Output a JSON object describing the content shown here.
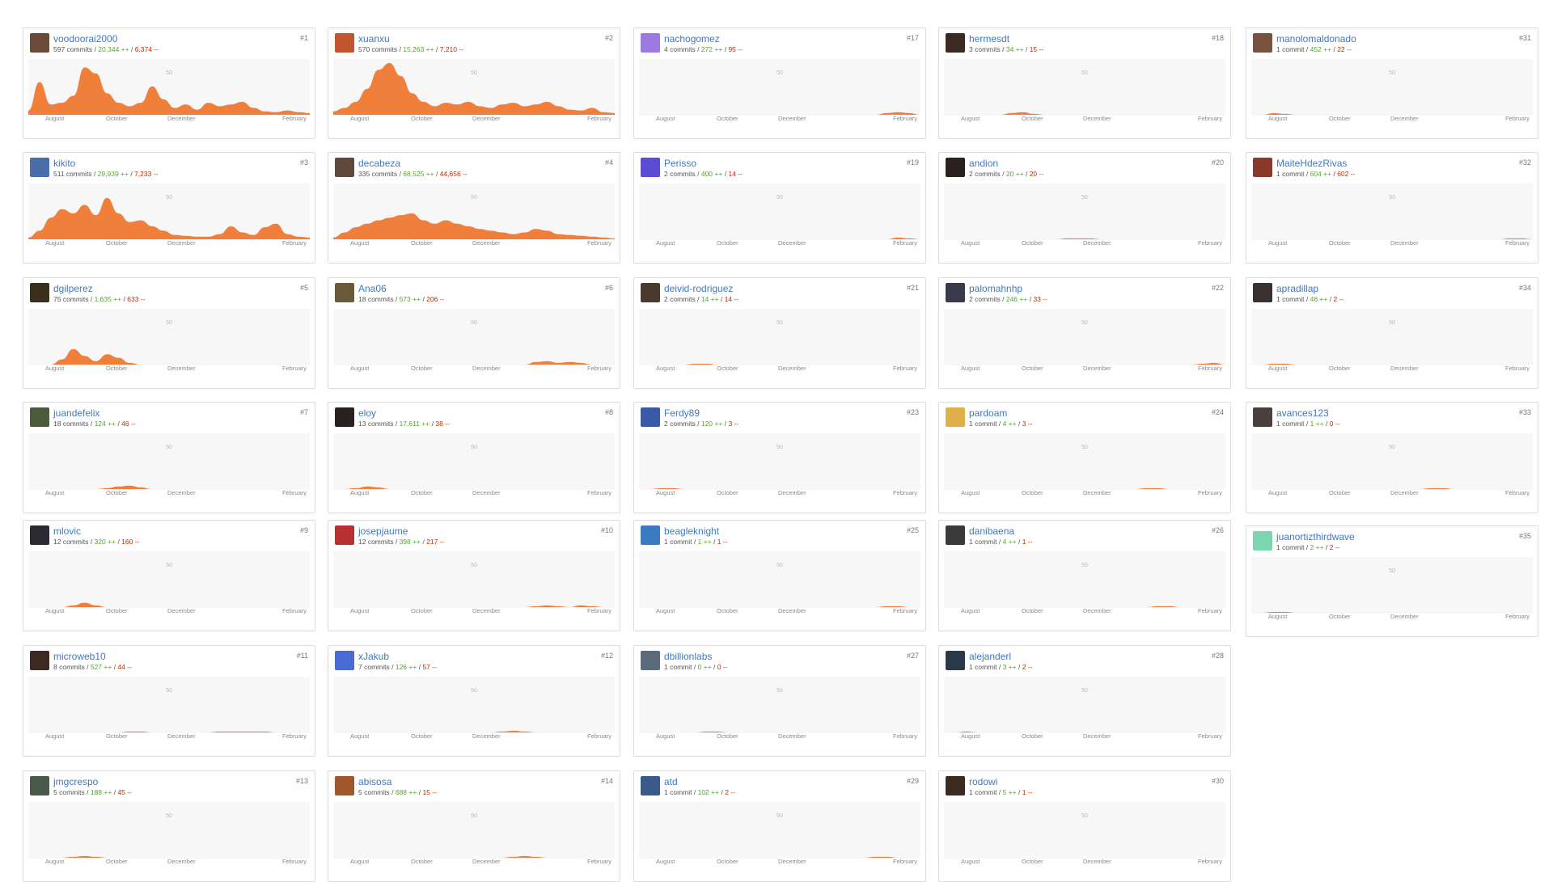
{
  "accent_color": "#f17f3c",
  "link_color": "#4078c0",
  "additions_color": "#55a532",
  "deletions_color": "#bd2c00",
  "plot_gridline_label": "50",
  "month_ticks": [
    "August",
    "October",
    "December",
    "February"
  ],
  "contributors": [
    {
      "username": "voodoorai2000",
      "commits_label": "597 commits",
      "adds": "20,344 ++",
      "dels": "6,374 --",
      "rank": "#1",
      "avatar_color": "#6b4a3a",
      "activity": [
        5,
        38,
        12,
        14,
        22,
        55,
        48,
        25,
        14,
        10,
        14,
        33,
        18,
        8,
        12,
        6,
        14,
        10,
        12,
        15,
        8,
        4,
        3,
        5,
        3,
        2
      ]
    },
    {
      "username": "xuanxu",
      "commits_label": "570 commits",
      "adds": "15,263 ++",
      "dels": "7,210 --",
      "rank": "#2",
      "avatar_color": "#c0552e",
      "activity": [
        4,
        8,
        15,
        30,
        52,
        60,
        45,
        25,
        15,
        10,
        14,
        12,
        15,
        10,
        8,
        12,
        14,
        10,
        12,
        15,
        10,
        6,
        5,
        8,
        3,
        2
      ]
    },
    {
      "username": "nachogomez",
      "commits_label": "4 commits",
      "adds": "272 ++",
      "dels": "95 --",
      "rank": "#17",
      "avatar_color": "#9b7be0",
      "activity": [
        0,
        0,
        0,
        0,
        0,
        0,
        0,
        0,
        0,
        0,
        0,
        0,
        0,
        0,
        0,
        0,
        0,
        0,
        0,
        0,
        0,
        0,
        2,
        3,
        2,
        0
      ]
    },
    {
      "username": "hermesdt",
      "commits_label": "3 commits",
      "adds": "34 ++",
      "dels": "15 --",
      "rank": "#18",
      "avatar_color": "#3a2a22",
      "activity": [
        0,
        0,
        0,
        0,
        0,
        0,
        2,
        3,
        1,
        0,
        0,
        0,
        0,
        0,
        0,
        0,
        0,
        0,
        0,
        0,
        0,
        0,
        0,
        0,
        0,
        0
      ]
    },
    {
      "username": "manolomaldonado",
      "commits_label": "1 commit",
      "adds": "452 ++",
      "dels": "22 --",
      "rank": "#31",
      "avatar_color": "#7a5340",
      "activity": [
        0,
        0,
        2,
        1,
        0,
        0,
        0,
        0,
        0,
        0,
        0,
        0,
        0,
        0,
        0,
        0,
        0,
        0,
        0,
        0,
        0,
        0,
        0,
        0,
        0,
        0
      ]
    },
    {
      "username": "kikito",
      "commits_label": "511 commits",
      "adds": "29,939 ++",
      "dels": "7,233 --",
      "rank": "#3",
      "avatar_color": "#4a6fa8",
      "activity": [
        2,
        10,
        25,
        35,
        30,
        40,
        28,
        48,
        30,
        20,
        22,
        15,
        10,
        5,
        4,
        3,
        3,
        6,
        15,
        8,
        5,
        14,
        18,
        6,
        3,
        2
      ]
    },
    {
      "username": "decabeza",
      "commits_label": "335 commits",
      "adds": "68,525 ++",
      "dels": "44,656 --",
      "rank": "#4",
      "avatar_color": "#5e4a3c",
      "activity": [
        2,
        8,
        14,
        18,
        22,
        25,
        28,
        30,
        22,
        18,
        22,
        18,
        15,
        12,
        10,
        8,
        6,
        8,
        12,
        10,
        6,
        5,
        4,
        3,
        2,
        1
      ]
    },
    {
      "username": "Perisso",
      "commits_label": "2 commits",
      "adds": "400 ++",
      "dels": "14 --",
      "rank": "#19",
      "avatar_color": "#5c4bd4",
      "activity": [
        0,
        0,
        0,
        0,
        0,
        0,
        0,
        0,
        0,
        0,
        0,
        0,
        0,
        0,
        0,
        0,
        0,
        0,
        0,
        0,
        0,
        0,
        0,
        2,
        1,
        0
      ]
    },
    {
      "username": "andion",
      "commits_label": "2 commits",
      "adds": "20 ++",
      "dels": "20 --",
      "rank": "#20",
      "avatar_color": "#2a2220",
      "activity": [
        0,
        0,
        0,
        0,
        0,
        0,
        0,
        0,
        0,
        0,
        0,
        1,
        1,
        1,
        0,
        0,
        0,
        0,
        0,
        0,
        0,
        0,
        0,
        0,
        0,
        0
      ]
    },
    {
      "username": "MaiteHdezRivas",
      "commits_label": "1 commit",
      "adds": "604 ++",
      "dels": "602 --",
      "rank": "#32",
      "avatar_color": "#8a3a2a",
      "activity": [
        0,
        0,
        0,
        0,
        0,
        0,
        0,
        0,
        0,
        0,
        0,
        0,
        0,
        0,
        0,
        0,
        0,
        0,
        0,
        0,
        0,
        0,
        0,
        1,
        1,
        0
      ]
    },
    {
      "username": "dgilperez",
      "commits_label": "75 commits",
      "adds": "1,635 ++",
      "dels": "633 --",
      "rank": "#5",
      "avatar_color": "#3a2f1a",
      "activity": [
        0,
        0,
        0,
        6,
        18,
        10,
        4,
        12,
        8,
        2,
        0,
        0,
        0,
        0,
        0,
        0,
        0,
        0,
        0,
        0,
        0,
        0,
        0,
        0,
        0,
        0
      ]
    },
    {
      "username": "Ana06",
      "commits_label": "18 commits",
      "adds": "573 ++",
      "dels": "206 --",
      "rank": "#6",
      "avatar_color": "#6b5a3a",
      "activity": [
        0,
        0,
        0,
        0,
        0,
        0,
        0,
        0,
        0,
        0,
        0,
        0,
        0,
        0,
        0,
        0,
        0,
        0,
        3,
        4,
        2,
        3,
        2,
        0,
        0,
        0
      ]
    },
    {
      "username": "deivid-rodriguez",
      "commits_label": "2 commits",
      "adds": "14 ++",
      "dels": "14 --",
      "rank": "#21",
      "avatar_color": "#4a3a30",
      "activity": [
        0,
        0,
        0,
        0,
        0,
        1,
        1,
        0,
        0,
        0,
        0,
        0,
        0,
        0,
        0,
        0,
        0,
        0,
        0,
        0,
        0,
        0,
        0,
        0,
        0,
        0
      ]
    },
    {
      "username": "palomahnhp",
      "commits_label": "2 commits",
      "adds": "246 ++",
      "dels": "33 --",
      "rank": "#22",
      "avatar_color": "#3a3a4a",
      "activity": [
        0,
        0,
        0,
        0,
        0,
        0,
        0,
        0,
        0,
        0,
        0,
        0,
        0,
        0,
        0,
        0,
        0,
        0,
        0,
        0,
        0,
        0,
        0,
        1,
        2,
        0
      ]
    },
    {
      "username": "apradillap",
      "commits_label": "1 commit",
      "adds": "46 ++",
      "dels": "2 --",
      "rank": "#34",
      "avatar_color": "#3a3030",
      "activity": [
        0,
        0,
        1,
        1,
        0,
        0,
        0,
        0,
        0,
        0,
        0,
        0,
        0,
        0,
        0,
        0,
        0,
        0,
        0,
        0,
        0,
        0,
        0,
        0,
        0,
        0
      ]
    },
    {
      "username": "juandefelix",
      "commits_label": "18 commits",
      "adds": "124 ++",
      "dels": "46 --",
      "rank": "#7",
      "avatar_color": "#4a5a3a",
      "activity": [
        0,
        0,
        0,
        0,
        0,
        0,
        0,
        1,
        3,
        4,
        2,
        0,
        0,
        0,
        0,
        0,
        0,
        0,
        0,
        0,
        0,
        0,
        0,
        0,
        0,
        0
      ]
    },
    {
      "username": "eloy",
      "commits_label": "13 commits",
      "adds": "17,611 ++",
      "dels": "38 --",
      "rank": "#8",
      "avatar_color": "#2a2220",
      "activity": [
        0,
        0,
        1,
        3,
        2,
        0,
        0,
        0,
        0,
        0,
        0,
        0,
        0,
        0,
        0,
        0,
        0,
        0,
        0,
        0,
        0,
        0,
        0,
        0,
        0,
        0
      ]
    },
    {
      "username": "Ferdy89",
      "commits_label": "2 commits",
      "adds": "120 ++",
      "dels": "3 --",
      "rank": "#23",
      "avatar_color": "#3a5aa8",
      "activity": [
        0,
        0,
        1,
        1,
        0,
        0,
        0,
        0,
        0,
        0,
        0,
        0,
        0,
        0,
        0,
        0,
        0,
        0,
        0,
        0,
        0,
        0,
        0,
        0,
        0,
        0
      ]
    },
    {
      "username": "pardoam",
      "commits_label": "1 commit",
      "adds": "4 ++",
      "dels": "3 --",
      "rank": "#24",
      "avatar_color": "#e0b04a",
      "activity": [
        0,
        0,
        0,
        0,
        0,
        0,
        0,
        0,
        0,
        0,
        0,
        0,
        0,
        0,
        0,
        0,
        0,
        0,
        1,
        1,
        0,
        0,
        0,
        0,
        0,
        0
      ]
    },
    {
      "username": "avances123",
      "commits_label": "1 commit",
      "adds": "1 ++",
      "dels": "0 --",
      "rank": "#33",
      "avatar_color": "#4a4040",
      "activity": [
        0,
        0,
        0,
        0,
        0,
        0,
        0,
        0,
        0,
        0,
        0,
        0,
        0,
        0,
        0,
        0,
        1,
        1,
        0,
        0,
        0,
        0,
        0,
        0,
        0,
        0
      ]
    },
    {
      "username": "mlovic",
      "commits_label": "12 commits",
      "adds": "320 ++",
      "dels": "160 --",
      "rank": "#9",
      "avatar_color": "#2a2a30",
      "activity": [
        0,
        0,
        0,
        0,
        2,
        5,
        2,
        0,
        0,
        0,
        0,
        0,
        0,
        0,
        0,
        0,
        0,
        0,
        0,
        0,
        0,
        0,
        0,
        0,
        0,
        0
      ]
    },
    {
      "username": "josepjaume",
      "commits_label": "12 commits",
      "adds": "398 ++",
      "dels": "217 --",
      "rank": "#10",
      "avatar_color": "#b83030",
      "activity": [
        0,
        0,
        0,
        0,
        0,
        0,
        0,
        0,
        0,
        0,
        0,
        0,
        0,
        0,
        0,
        0,
        0,
        0,
        1,
        2,
        1,
        0,
        2,
        1,
        0,
        0
      ]
    },
    {
      "username": "beagleknight",
      "commits_label": "1 commit",
      "adds": "1 ++",
      "dels": "1 --",
      "rank": "#25",
      "avatar_color": "#3a7ac0",
      "activity": [
        0,
        0,
        0,
        0,
        0,
        0,
        0,
        0,
        0,
        0,
        0,
        0,
        0,
        0,
        0,
        0,
        0,
        0,
        0,
        0,
        0,
        0,
        1,
        1,
        0,
        0
      ]
    },
    {
      "username": "danibaena",
      "commits_label": "1 commit",
      "adds": "4 ++",
      "dels": "1 --",
      "rank": "#26",
      "avatar_color": "#3a3a3a",
      "activity": [
        0,
        0,
        0,
        0,
        0,
        0,
        0,
        0,
        0,
        0,
        0,
        0,
        0,
        0,
        0,
        0,
        0,
        0,
        0,
        1,
        1,
        0,
        0,
        0,
        0,
        0
      ]
    },
    {
      "username": "juanortizthirdwave",
      "commits_label": "1 commit",
      "adds": "2 ++",
      "dels": "2 --",
      "rank": "#35",
      "avatar_color": "#7ed6b0",
      "activity": [
        0,
        0,
        1,
        1,
        0,
        0,
        0,
        0,
        0,
        0,
        0,
        0,
        0,
        0,
        0,
        0,
        0,
        0,
        0,
        0,
        0,
        0,
        0,
        0,
        0,
        0
      ]
    },
    {
      "username": "microweb10",
      "commits_label": "8 commits",
      "adds": "527 ++",
      "dels": "44 --",
      "rank": "#11",
      "avatar_color": "#3a2a20",
      "activity": [
        0,
        0,
        0,
        0,
        0,
        0,
        0,
        0,
        0,
        1,
        1,
        0,
        0,
        0,
        0,
        0,
        0,
        1,
        1,
        1,
        1,
        1,
        0,
        0,
        0,
        0
      ]
    },
    {
      "username": "xJakub",
      "commits_label": "7 commits",
      "adds": "126 ++",
      "dels": "57 --",
      "rank": "#12",
      "avatar_color": "#4a6ad8",
      "activity": [
        0,
        0,
        0,
        0,
        0,
        0,
        0,
        0,
        0,
        0,
        0,
        0,
        0,
        0,
        0,
        1,
        2,
        1,
        0,
        0,
        0,
        0,
        0,
        0,
        0,
        0
      ]
    },
    {
      "username": "dbillionlabs",
      "commits_label": "1 commit",
      "adds": "0 ++",
      "dels": "0 --",
      "rank": "#27",
      "avatar_color": "#5a6a7a",
      "activity": [
        0,
        0,
        0,
        0,
        0,
        0,
        1,
        1,
        0,
        0,
        0,
        0,
        0,
        0,
        0,
        0,
        0,
        0,
        0,
        0,
        0,
        0,
        0,
        0,
        0,
        0
      ]
    },
    {
      "username": "alejanderl",
      "commits_label": "1 commit",
      "adds": "3 ++",
      "dels": "2 --",
      "rank": "#28",
      "avatar_color": "#2a3a4a",
      "activity": [
        0,
        0,
        1,
        0,
        0,
        0,
        0,
        0,
        0,
        0,
        0,
        0,
        0,
        0,
        0,
        0,
        0,
        0,
        0,
        0,
        0,
        0,
        0,
        0,
        0,
        0
      ]
    },
    {
      "username": "jmgcrespo",
      "commits_label": "5 commits",
      "adds": "188 ++",
      "dels": "45 --",
      "rank": "#13",
      "avatar_color": "#4a5a4a",
      "activity": [
        0,
        0,
        0,
        0,
        1,
        2,
        1,
        0,
        0,
        0,
        0,
        0,
        0,
        0,
        0,
        0,
        0,
        0,
        0,
        0,
        0,
        0,
        0,
        0,
        0,
        0
      ]
    },
    {
      "username": "abisosa",
      "commits_label": "5 commits",
      "adds": "688 ++",
      "dels": "15 --",
      "rank": "#14",
      "avatar_color": "#a0552a",
      "activity": [
        0,
        0,
        0,
        0,
        0,
        0,
        0,
        0,
        0,
        0,
        0,
        0,
        0,
        0,
        0,
        0,
        1,
        2,
        1,
        0,
        0,
        0,
        0,
        0,
        0,
        0
      ]
    },
    {
      "username": "atd",
      "commits_label": "1 commit",
      "adds": "102 ++",
      "dels": "2 --",
      "rank": "#29",
      "avatar_color": "#3a5a8a",
      "activity": [
        0,
        0,
        0,
        0,
        0,
        0,
        0,
        0,
        0,
        0,
        0,
        0,
        0,
        0,
        0,
        0,
        0,
        0,
        0,
        0,
        0,
        1,
        1,
        0,
        0,
        0
      ]
    },
    {
      "username": "rodowi",
      "commits_label": "1 commit",
      "adds": "5 ++",
      "dels": "1 --",
      "rank": "#30",
      "avatar_color": "#3a2a20",
      "activity": [
        0,
        0,
        0,
        0,
        0,
        0,
        0,
        0,
        0,
        0,
        0,
        0,
        0,
        0,
        0,
        0,
        0,
        0,
        0,
        0,
        0,
        0,
        0,
        0,
        0,
        0
      ]
    }
  ]
}
